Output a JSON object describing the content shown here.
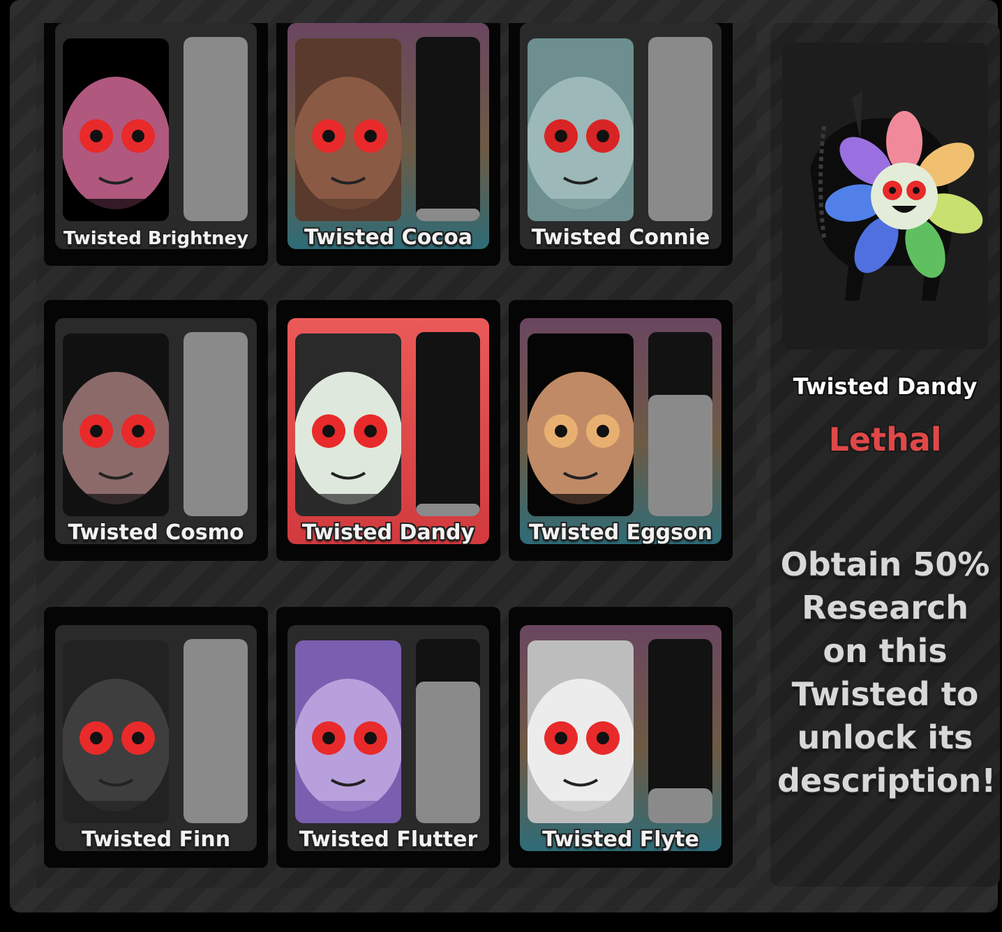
{
  "cards": [
    {
      "name": "Twisted Brightney",
      "research": 1.0,
      "style": "plain",
      "skin": "#b0587e",
      "dark": "#000000",
      "eye": "#e82a2a"
    },
    {
      "name": "Twisted Cocoa",
      "research": 0.07,
      "style": "rare",
      "skin": "#8a5a44",
      "dark": "#5a3a2c",
      "eye": "#e82a2a"
    },
    {
      "name": "Twisted Connie",
      "research": 1.0,
      "style": "plain",
      "skin": "#9cb8b8",
      "dark": "#6d8f8f",
      "eye": "#d82424"
    },
    {
      "name": "Twisted Cosmo",
      "research": 1.0,
      "style": "plain",
      "skin": "#8c6a6a",
      "dark": "#111111",
      "eye": "#e82a2a"
    },
    {
      "name": "Twisted Dandy",
      "research": 0.07,
      "style": "selected",
      "skin": "#dfe8dc",
      "dark": "#2a2a2a",
      "eye": "#e82a2a"
    },
    {
      "name": "Twisted Eggson",
      "research": 0.66,
      "style": "rare",
      "skin": "#c08a66",
      "dark": "#050505",
      "eye": "#e8b070"
    },
    {
      "name": "Twisted Finn",
      "research": 1.0,
      "style": "plain",
      "skin": "#3e3e3e",
      "dark": "#222222",
      "eye": "#e82a2a"
    },
    {
      "name": "Twisted Flutter",
      "research": 0.77,
      "style": "plain",
      "skin": "#b8a0dc",
      "dark": "#7a5fb0",
      "eye": "#e82a2a"
    },
    {
      "name": "Twisted Flyte",
      "research": 0.19,
      "style": "rare",
      "skin": "#ececec",
      "dark": "#bdbdbd",
      "eye": "#e82a2a"
    }
  ],
  "selected": {
    "name": "Twisted Dandy",
    "rarity": "Lethal",
    "description": "Obtain 50% Research on this Twisted to unlock its description!"
  },
  "colors": {
    "lethal": "#e04848",
    "meter_fill": "#8a8a8a",
    "meter_track": "#121212"
  }
}
